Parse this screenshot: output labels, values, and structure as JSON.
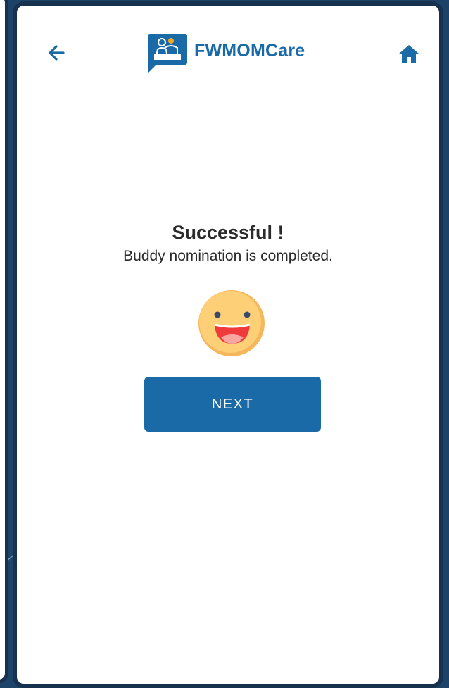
{
  "app": {
    "name": "FWMOMCare"
  },
  "header": {
    "back_icon": "arrow-left-icon",
    "home_icon": "home-icon",
    "logo_icon": "chat-people-logo-icon"
  },
  "message": {
    "title": "Successful !",
    "subtitle": "Buddy nomination is completed.",
    "emoji_icon": "smiling-face-icon"
  },
  "actions": {
    "next_label": "NEXT"
  },
  "colors": {
    "brand_blue": "#1a6aa8",
    "frame": "#17324f",
    "text": "#2b2b2b",
    "emoji_face": "#fdd077",
    "emoji_mouth": "#ef3b3b"
  }
}
